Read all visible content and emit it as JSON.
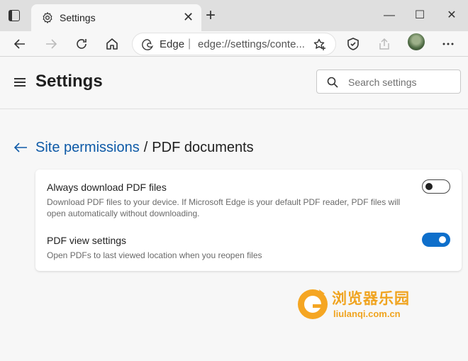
{
  "browser": {
    "tab": {
      "title": "Settings"
    },
    "address": {
      "label": "Edge",
      "separator": "|",
      "url": "edge://settings/conte..."
    }
  },
  "settings": {
    "title": "Settings",
    "search": {
      "placeholder": "Search settings"
    }
  },
  "breadcrumb": {
    "parent": "Site permissions",
    "separator": "/",
    "current": "PDF documents"
  },
  "options": [
    {
      "title": "Always download PDF files",
      "description": "Download PDF files to your device. If Microsoft Edge is your default PDF reader, PDF files will open automatically without downloading.",
      "enabled": false
    },
    {
      "title": "PDF view settings",
      "description": "Open PDFs to last viewed location when you reopen files",
      "enabled": true
    }
  ],
  "watermark": {
    "text_cn": "浏览器乐园",
    "text_en": "liulanqi.com.cn"
  },
  "colors": {
    "accent": "#0e6fcb",
    "link": "#0e5aa7",
    "watermark": "#f0a420"
  }
}
